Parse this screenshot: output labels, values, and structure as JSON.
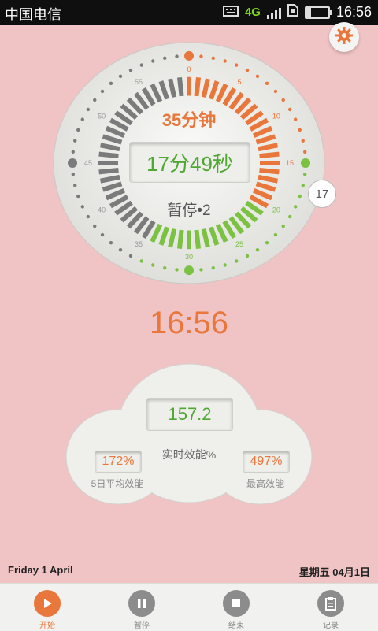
{
  "status_bar": {
    "carrier": "中国电信",
    "network": "4G",
    "time": "16:56"
  },
  "settings": {
    "icon": "gear-icon"
  },
  "timer": {
    "total_label": "35分钟",
    "remaining": "17分49秒",
    "status": "暂停•2",
    "side_badge": "17",
    "scale_labels": [
      "0",
      "5",
      "10",
      "15",
      "20",
      "25",
      "30",
      "35",
      "40",
      "45",
      "50",
      "55"
    ]
  },
  "clock": "16:56",
  "efficiency": {
    "realtime_value": "157.2",
    "realtime_label": "实时效能%",
    "avg5_value": "172%",
    "avg5_label": "5日平均效能",
    "peak_value": "497%",
    "peak_label": "最高效能"
  },
  "dates": {
    "left": "Friday 1 April",
    "right": "星期五 04月1日"
  },
  "nav": {
    "items": [
      {
        "label": "开始",
        "icon": "play-icon"
      },
      {
        "label": "暂停",
        "icon": "pause-icon"
      },
      {
        "label": "结束",
        "icon": "stop-icon"
      },
      {
        "label": "记录",
        "icon": "clipboard-icon"
      }
    ]
  },
  "colors": {
    "accent": "#e9763a",
    "green": "#4ea832",
    "background": "#f0c4c4"
  }
}
